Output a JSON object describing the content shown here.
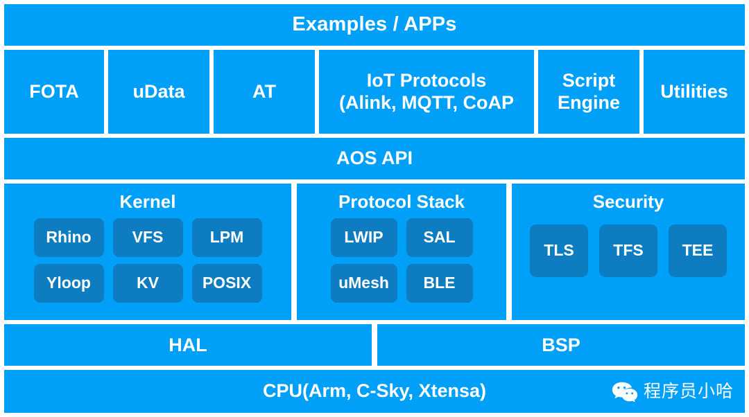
{
  "diagram": {
    "title": "AliOS Things software architecture layers",
    "colors": {
      "layer_blue": "#00a0f8",
      "chip_blue": "#0d7cc0",
      "background": "#ffffff",
      "text": "#ffffff"
    },
    "layers": [
      {
        "id": "applications",
        "label": "Examples / APPs"
      },
      {
        "id": "components",
        "items": [
          {
            "label": "FOTA"
          },
          {
            "label": "uData"
          },
          {
            "label": "AT"
          },
          {
            "label": "IoT Protocols\n(Alink, MQTT, CoAP",
            "line1": "IoT Protocols",
            "line2": "(Alink, MQTT, CoAP"
          },
          {
            "label": "Script Engine",
            "line1": "Script",
            "line2": "Engine"
          },
          {
            "label": "Utilities"
          }
        ]
      },
      {
        "id": "aos-api",
        "label": "AOS API"
      },
      {
        "id": "core-sections",
        "sections": [
          {
            "title": "Kernel",
            "modules": [
              "Rhino",
              "VFS",
              "LPM",
              "Yloop",
              "KV",
              "POSIX"
            ]
          },
          {
            "title": "Protocol Stack",
            "modules": [
              "LWIP",
              "SAL",
              "uMesh",
              "BLE"
            ]
          },
          {
            "title": "Security",
            "modules": [
              "TLS",
              "TFS",
              "TEE"
            ]
          }
        ]
      },
      {
        "id": "hal-bsp",
        "cells": [
          {
            "label": "HAL"
          },
          {
            "label": "BSP"
          }
        ]
      },
      {
        "id": "cpu",
        "label": "CPU(Arm, C-Sky, Xtensa)"
      }
    ],
    "watermark": {
      "icon": "wechat-icon",
      "text": "程序员小哈"
    }
  }
}
